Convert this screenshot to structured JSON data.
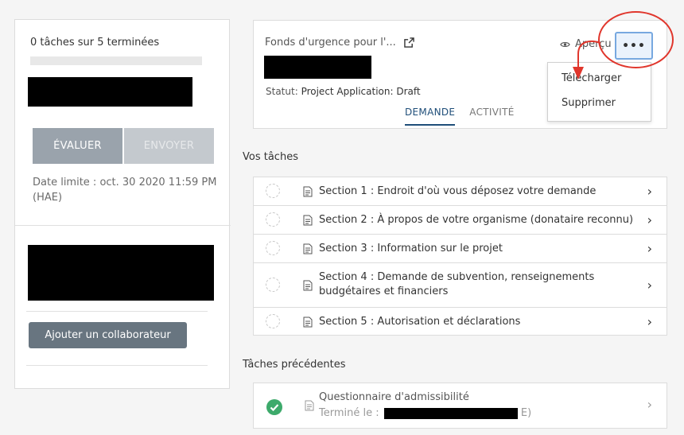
{
  "left": {
    "progress_text": "0 tâches sur 5 terminées",
    "progress_fraction": 0,
    "evaluate_label": "ÉVALUER",
    "send_label": "ENVOYER",
    "deadline": "Date limite : oct. 30 2020 11:59 PM (HAE)",
    "add_collaborator_label": "Ajouter un collaborateur"
  },
  "card": {
    "title": "Fonds d'urgence pour l'...",
    "status_label": "Statut:",
    "status_value": "Project Application: Draft",
    "tabs": [
      {
        "label": "DEMANDE"
      },
      {
        "label": "ACTIVITÉ"
      }
    ],
    "preview_label": "Aperçu",
    "more_label": "•••"
  },
  "menu": {
    "items": [
      {
        "label": "Télécharger"
      },
      {
        "label": "Supprimer"
      }
    ]
  },
  "tasks": {
    "heading": "Vos tâches",
    "items": [
      {
        "label": "Section 1 : Endroit d'où vous déposez votre demande"
      },
      {
        "label": "Section 2 : À propos de votre organisme (donataire reconnu)"
      },
      {
        "label": "Section 3 : Information sur le projet"
      },
      {
        "label": "Section 4 : Demande de subvention, renseignements budgétaires et financiers"
      },
      {
        "label": "Section 5 : Autorisation et déclarations"
      }
    ]
  },
  "previous": {
    "heading": "Tâches précédentes",
    "title": "Questionnaire d'admissibilité",
    "completed_label": "Terminé le :",
    "completed_suffix": "E)"
  },
  "colors": {
    "accent": "#1f4e79",
    "annotation": "#e0362c",
    "success": "#3daa6b"
  }
}
